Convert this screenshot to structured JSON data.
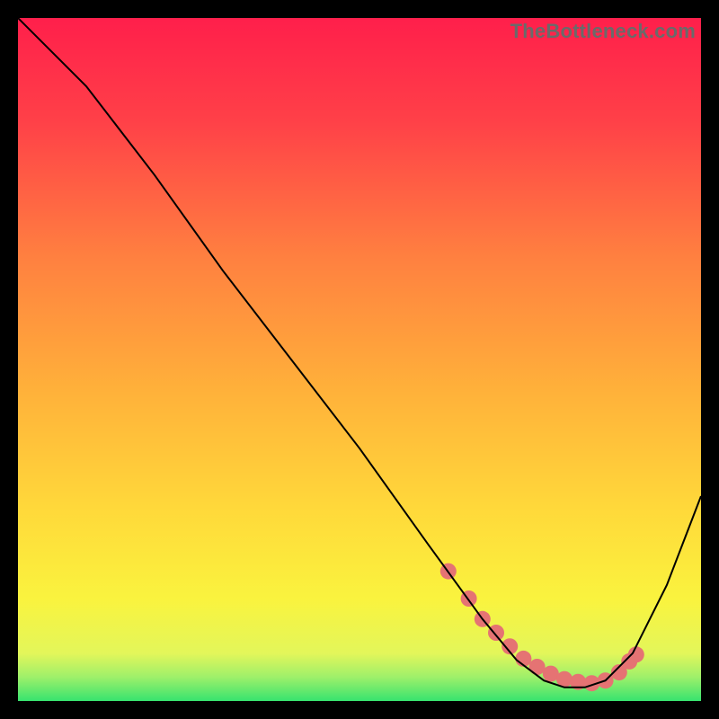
{
  "watermark": "TheBottleneck.com",
  "chart_data": {
    "type": "line",
    "title": "",
    "xlabel": "",
    "ylabel": "",
    "xlim": [
      0,
      100
    ],
    "ylim": [
      0,
      100
    ],
    "x": [
      0,
      3,
      10,
      20,
      30,
      40,
      50,
      60,
      68,
      73,
      77,
      80,
      83,
      86,
      90,
      95,
      100
    ],
    "y": [
      100,
      97,
      90,
      77,
      63,
      50,
      37,
      23,
      12,
      6,
      3,
      2,
      2,
      3,
      7,
      17,
      30
    ],
    "optimal_band": {
      "y0": 0,
      "y1": 4
    },
    "optimal_marker_segment": {
      "x": [
        63,
        66,
        68,
        70,
        72,
        74,
        76,
        78,
        80,
        82,
        84,
        86,
        88,
        89.5,
        90.5
      ],
      "y": [
        19,
        15,
        12,
        10,
        8,
        6.2,
        5,
        4,
        3.2,
        2.8,
        2.6,
        3,
        4.2,
        5.8,
        6.8
      ]
    },
    "gradient_stops": [
      {
        "offset": 0.0,
        "color": "#ff1f4b"
      },
      {
        "offset": 0.15,
        "color": "#ff4048"
      },
      {
        "offset": 0.35,
        "color": "#ff8040"
      },
      {
        "offset": 0.55,
        "color": "#ffb23a"
      },
      {
        "offset": 0.72,
        "color": "#ffd93a"
      },
      {
        "offset": 0.85,
        "color": "#faf33e"
      },
      {
        "offset": 0.93,
        "color": "#e3f65a"
      },
      {
        "offset": 0.965,
        "color": "#9ef06a"
      },
      {
        "offset": 1.0,
        "color": "#37e36f"
      }
    ],
    "curve_color": "#000000",
    "marker_color": "#e57373"
  }
}
